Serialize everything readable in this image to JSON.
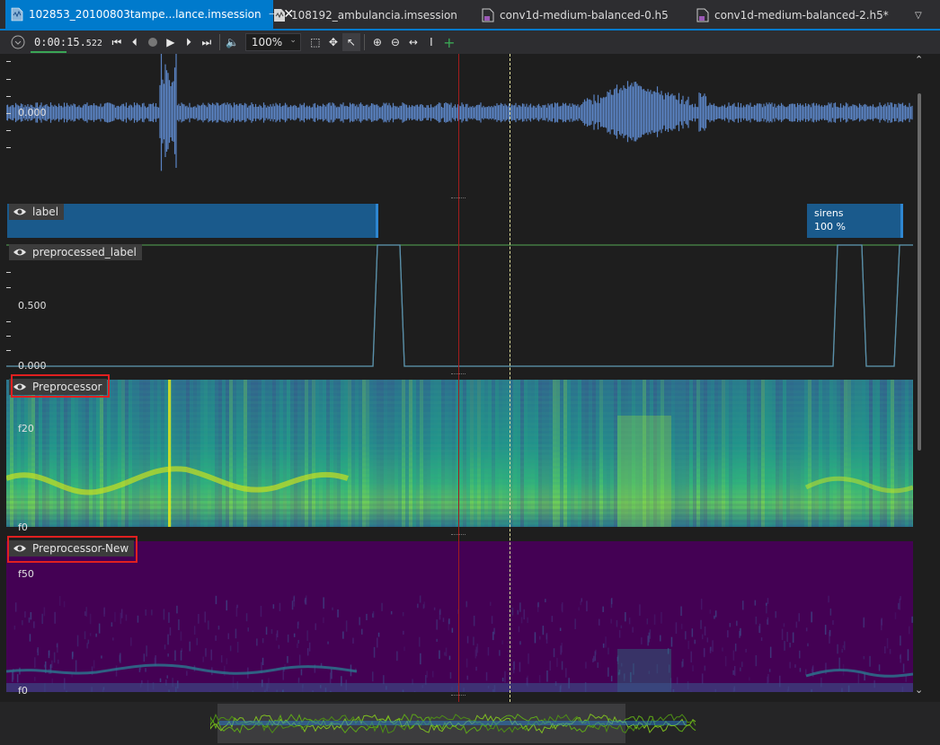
{
  "tabs": [
    {
      "label": "102853_20100803tampe...lance.imsession",
      "active": true,
      "pinned": true
    },
    {
      "label": "108192_ambulancia.imsession",
      "active": false
    },
    {
      "label": "conv1d-medium-balanced-0.h5",
      "active": false
    },
    {
      "label": "conv1d-medium-balanced-2.h5*",
      "active": false
    }
  ],
  "toolbar": {
    "time_main": "0:00:15.",
    "time_ms": "522",
    "zoom": "100%"
  },
  "tracks": {
    "waveform": {
      "axis_label": "0.000"
    },
    "label": {
      "name": "label",
      "segment_text": "sirens",
      "segment_value": "100 %"
    },
    "preprocessed_label": {
      "name": "preprocessed_label",
      "axis_top": "0.500",
      "axis_bottom": "0.000"
    },
    "preprocessor": {
      "name": "Preprocessor",
      "axis_top": "f20",
      "axis_bottom": "f0"
    },
    "preprocessor_new": {
      "name": "Preprocessor-New",
      "axis_top": "f50",
      "axis_bottom": "f0"
    }
  },
  "colors": {
    "accent": "#007acc",
    "waveform": "#5b84c4",
    "label_segment": "#1a5a8c",
    "cursor_red": "#a31d1d",
    "cursor_yellow": "#e8e6a0",
    "highlight_box": "#e02020"
  }
}
